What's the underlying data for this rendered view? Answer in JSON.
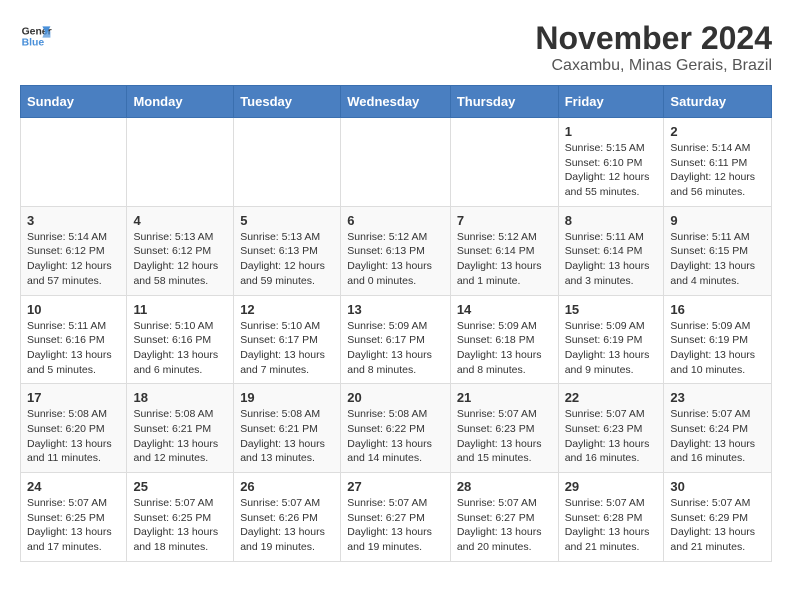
{
  "logo": {
    "line1": "General",
    "line2": "Blue"
  },
  "title": "November 2024",
  "subtitle": "Caxambu, Minas Gerais, Brazil",
  "days_of_week": [
    "Sunday",
    "Monday",
    "Tuesday",
    "Wednesday",
    "Thursday",
    "Friday",
    "Saturday"
  ],
  "weeks": [
    [
      {
        "day": "",
        "info": ""
      },
      {
        "day": "",
        "info": ""
      },
      {
        "day": "",
        "info": ""
      },
      {
        "day": "",
        "info": ""
      },
      {
        "day": "",
        "info": ""
      },
      {
        "day": "1",
        "info": "Sunrise: 5:15 AM\nSunset: 6:10 PM\nDaylight: 12 hours\nand 55 minutes."
      },
      {
        "day": "2",
        "info": "Sunrise: 5:14 AM\nSunset: 6:11 PM\nDaylight: 12 hours\nand 56 minutes."
      }
    ],
    [
      {
        "day": "3",
        "info": "Sunrise: 5:14 AM\nSunset: 6:12 PM\nDaylight: 12 hours\nand 57 minutes."
      },
      {
        "day": "4",
        "info": "Sunrise: 5:13 AM\nSunset: 6:12 PM\nDaylight: 12 hours\nand 58 minutes."
      },
      {
        "day": "5",
        "info": "Sunrise: 5:13 AM\nSunset: 6:13 PM\nDaylight: 12 hours\nand 59 minutes."
      },
      {
        "day": "6",
        "info": "Sunrise: 5:12 AM\nSunset: 6:13 PM\nDaylight: 13 hours\nand 0 minutes."
      },
      {
        "day": "7",
        "info": "Sunrise: 5:12 AM\nSunset: 6:14 PM\nDaylight: 13 hours\nand 1 minute."
      },
      {
        "day": "8",
        "info": "Sunrise: 5:11 AM\nSunset: 6:14 PM\nDaylight: 13 hours\nand 3 minutes."
      },
      {
        "day": "9",
        "info": "Sunrise: 5:11 AM\nSunset: 6:15 PM\nDaylight: 13 hours\nand 4 minutes."
      }
    ],
    [
      {
        "day": "10",
        "info": "Sunrise: 5:11 AM\nSunset: 6:16 PM\nDaylight: 13 hours\nand 5 minutes."
      },
      {
        "day": "11",
        "info": "Sunrise: 5:10 AM\nSunset: 6:16 PM\nDaylight: 13 hours\nand 6 minutes."
      },
      {
        "day": "12",
        "info": "Sunrise: 5:10 AM\nSunset: 6:17 PM\nDaylight: 13 hours\nand 7 minutes."
      },
      {
        "day": "13",
        "info": "Sunrise: 5:09 AM\nSunset: 6:17 PM\nDaylight: 13 hours\nand 8 minutes."
      },
      {
        "day": "14",
        "info": "Sunrise: 5:09 AM\nSunset: 6:18 PM\nDaylight: 13 hours\nand 8 minutes."
      },
      {
        "day": "15",
        "info": "Sunrise: 5:09 AM\nSunset: 6:19 PM\nDaylight: 13 hours\nand 9 minutes."
      },
      {
        "day": "16",
        "info": "Sunrise: 5:09 AM\nSunset: 6:19 PM\nDaylight: 13 hours\nand 10 minutes."
      }
    ],
    [
      {
        "day": "17",
        "info": "Sunrise: 5:08 AM\nSunset: 6:20 PM\nDaylight: 13 hours\nand 11 minutes."
      },
      {
        "day": "18",
        "info": "Sunrise: 5:08 AM\nSunset: 6:21 PM\nDaylight: 13 hours\nand 12 minutes."
      },
      {
        "day": "19",
        "info": "Sunrise: 5:08 AM\nSunset: 6:21 PM\nDaylight: 13 hours\nand 13 minutes."
      },
      {
        "day": "20",
        "info": "Sunrise: 5:08 AM\nSunset: 6:22 PM\nDaylight: 13 hours\nand 14 minutes."
      },
      {
        "day": "21",
        "info": "Sunrise: 5:07 AM\nSunset: 6:23 PM\nDaylight: 13 hours\nand 15 minutes."
      },
      {
        "day": "22",
        "info": "Sunrise: 5:07 AM\nSunset: 6:23 PM\nDaylight: 13 hours\nand 16 minutes."
      },
      {
        "day": "23",
        "info": "Sunrise: 5:07 AM\nSunset: 6:24 PM\nDaylight: 13 hours\nand 16 minutes."
      }
    ],
    [
      {
        "day": "24",
        "info": "Sunrise: 5:07 AM\nSunset: 6:25 PM\nDaylight: 13 hours\nand 17 minutes."
      },
      {
        "day": "25",
        "info": "Sunrise: 5:07 AM\nSunset: 6:25 PM\nDaylight: 13 hours\nand 18 minutes."
      },
      {
        "day": "26",
        "info": "Sunrise: 5:07 AM\nSunset: 6:26 PM\nDaylight: 13 hours\nand 19 minutes."
      },
      {
        "day": "27",
        "info": "Sunrise: 5:07 AM\nSunset: 6:27 PM\nDaylight: 13 hours\nand 19 minutes."
      },
      {
        "day": "28",
        "info": "Sunrise: 5:07 AM\nSunset: 6:27 PM\nDaylight: 13 hours\nand 20 minutes."
      },
      {
        "day": "29",
        "info": "Sunrise: 5:07 AM\nSunset: 6:28 PM\nDaylight: 13 hours\nand 21 minutes."
      },
      {
        "day": "30",
        "info": "Sunrise: 5:07 AM\nSunset: 6:29 PM\nDaylight: 13 hours\nand 21 minutes."
      }
    ]
  ]
}
